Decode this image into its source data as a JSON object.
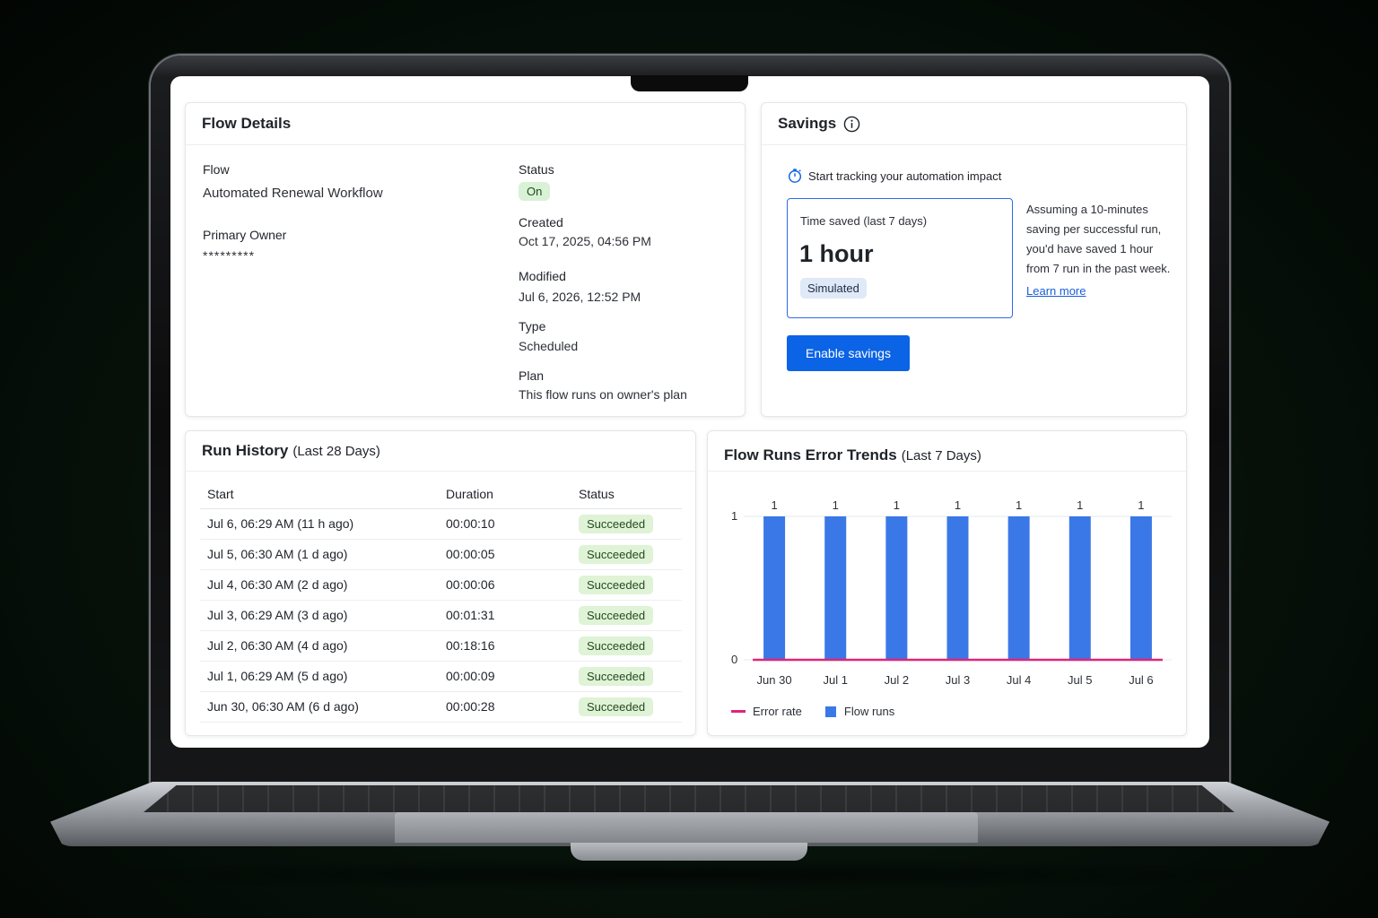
{
  "flow_details": {
    "title": "Flow Details",
    "flow_label": "Flow",
    "flow_name": "Automated Renewal Workflow",
    "owner_label": "Primary Owner",
    "owner_value": "*********",
    "status_label": "Status",
    "status_value": "On",
    "created_label": "Created",
    "created_value": "Oct 17, 2025, 04:56 PM",
    "modified_label": "Modified",
    "modified_value": "Jul 6, 2026, 12:52 PM",
    "type_label": "Type",
    "type_value": "Scheduled",
    "plan_label": "Plan",
    "plan_value": "This flow runs on owner's plan"
  },
  "savings": {
    "title": "Savings",
    "tracking_text": "Start tracking your automation impact",
    "time_saved_label": "Time saved (last 7 days)",
    "time_saved_value": "1 hour",
    "simulated_chip": "Simulated",
    "assumption_line1": "Assuming a 10-minutes",
    "assumption_line2": "saving per successful run,",
    "assumption_line3": "you'd have saved 1 hour",
    "assumption_line4": "from 7 run in the past week.",
    "learn_more": "Learn more",
    "enable_button": "Enable savings"
  },
  "run_history": {
    "title": "Run History",
    "subtitle": "(Last 28 Days)",
    "columns": [
      "Start",
      "Duration",
      "Status"
    ],
    "rows": [
      {
        "start": "Jul 6, 06:29 AM (11 h ago)",
        "duration": "00:00:10",
        "status": "Succeeded"
      },
      {
        "start": "Jul 5, 06:30 AM (1 d ago)",
        "duration": "00:00:05",
        "status": "Succeeded"
      },
      {
        "start": "Jul 4, 06:30 AM (2 d ago)",
        "duration": "00:00:06",
        "status": "Succeeded"
      },
      {
        "start": "Jul 3, 06:29 AM (3 d ago)",
        "duration": "00:01:31",
        "status": "Succeeded"
      },
      {
        "start": "Jul 2, 06:30 AM (4 d ago)",
        "duration": "00:18:16",
        "status": "Succeeded"
      },
      {
        "start": "Jul 1, 06:29 AM (5 d ago)",
        "duration": "00:00:09",
        "status": "Succeeded"
      },
      {
        "start": "Jun 30, 06:30 AM (6 d ago)",
        "duration": "00:00:28",
        "status": "Succeeded"
      }
    ]
  },
  "error_trends": {
    "title": "Flow Runs Error Trends",
    "subtitle": "(Last 7 Days)",
    "legend_error": "Error rate",
    "legend_runs": "Flow runs"
  },
  "chart_data": {
    "type": "bar",
    "title": "Flow Runs Error Trends (Last 7 Days)",
    "categories": [
      "Jun 30",
      "Jul 1",
      "Jul 2",
      "Jul 3",
      "Jul 4",
      "Jul 5",
      "Jul 6"
    ],
    "series": [
      {
        "name": "Flow runs",
        "type": "bar",
        "color": "#3b78e7",
        "values": [
          1,
          1,
          1,
          1,
          1,
          1,
          1
        ]
      },
      {
        "name": "Error rate",
        "type": "line",
        "color": "#e0247a",
        "values": [
          0,
          0,
          0,
          0,
          0,
          0,
          0
        ]
      }
    ],
    "ylim": [
      0,
      1
    ],
    "yticks": [
      "0",
      "1"
    ],
    "data_labels": [
      "1",
      "1",
      "1",
      "1",
      "1",
      "1",
      "1"
    ],
    "grid": true,
    "legend": "bottom-left"
  },
  "colors": {
    "primary": "#0b63e6",
    "success_bg": "#dff3d6",
    "bar": "#3b78e7",
    "error_line": "#e0247a"
  }
}
